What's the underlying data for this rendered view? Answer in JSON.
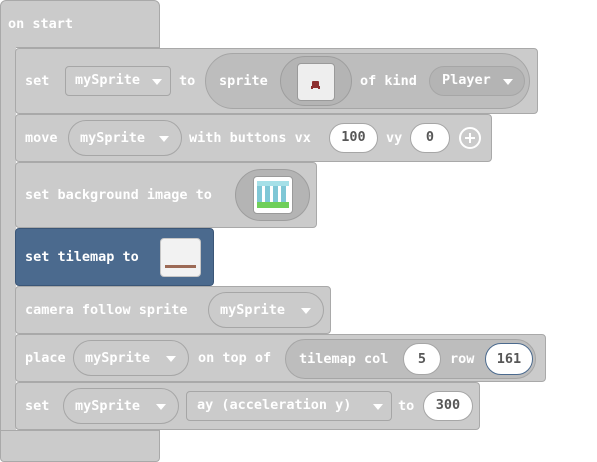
{
  "workspace": {
    "hat_label": "on start",
    "rows": {
      "set_sprite": {
        "prefix": "set",
        "variable": "mySprite",
        "to": "to",
        "reporter_label": "sprite",
        "of_kind": "of kind",
        "kind": "Player"
      },
      "move": {
        "prefix": "move",
        "variable": "mySprite",
        "with_buttons": "with buttons vx",
        "vx": "100",
        "vy_label": "vy",
        "vy": "0"
      },
      "background": {
        "label": "set background image to"
      },
      "tilemap": {
        "label": "set tilemap to"
      },
      "camera": {
        "label": "camera follow sprite",
        "variable": "mySprite"
      },
      "place": {
        "prefix": "place",
        "variable": "mySprite",
        "on_top_of": "on top of",
        "tile_label": "tilemap col",
        "col": "5",
        "row_label": "row",
        "row": "161"
      },
      "set_accel": {
        "prefix": "set",
        "variable": "mySprite",
        "property": "ay (acceleration y)",
        "to": "to",
        "value": "300"
      }
    }
  },
  "colors": {
    "block_gray": "#cbcbcb",
    "reporter_gray": "#bdbdbd",
    "tilemap_blue": "#4b6a8e",
    "text_white": "#ffffff"
  }
}
